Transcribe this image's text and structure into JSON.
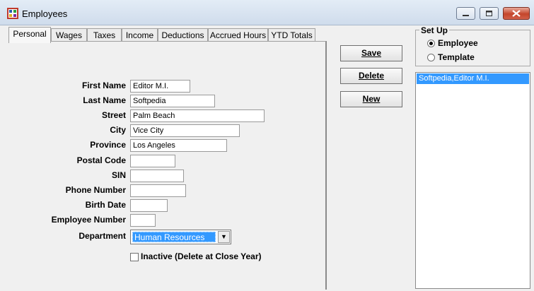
{
  "window": {
    "title": "Employees"
  },
  "tabs": [
    {
      "label": "Personal"
    },
    {
      "label": "Wages"
    },
    {
      "label": "Taxes"
    },
    {
      "label": "Income"
    },
    {
      "label": "Deductions"
    },
    {
      "label": "Accrued Hours"
    },
    {
      "label": "YTD Totals"
    }
  ],
  "form": {
    "fields": [
      {
        "label": "First Name",
        "value": "Editor M.I."
      },
      {
        "label": "Last Name",
        "value": "Softpedia"
      },
      {
        "label": "Street",
        "value": "Palm Beach"
      },
      {
        "label": "City",
        "value": "Vice City"
      },
      {
        "label": "Province",
        "value": "Los Angeles"
      },
      {
        "label": "Postal Code",
        "value": ""
      },
      {
        "label": "SIN",
        "value": ""
      },
      {
        "label": "Phone Number",
        "value": ""
      },
      {
        "label": "Birth Date",
        "value": ""
      },
      {
        "label": "Employee Number",
        "value": ""
      }
    ],
    "department": {
      "label": "Department",
      "value": "Human Resources"
    },
    "inactive": {
      "label": "Inactive (Delete at Close Year)",
      "checked": false
    }
  },
  "buttons": {
    "save": "Save",
    "delete": "Delete",
    "new": "New"
  },
  "setup": {
    "title": "Set Up",
    "options": [
      {
        "label": "Employee",
        "selected": true
      },
      {
        "label": "Template",
        "selected": false
      }
    ]
  },
  "employee_list": [
    {
      "name": "Softpedia,Editor M.I.",
      "selected": true
    }
  ],
  "icons": {
    "app": "employees-app-icon",
    "minimize": "minimize-icon",
    "maximize": "maximize-icon",
    "close": "close-icon",
    "dropdown": "chevron-down-icon"
  },
  "colors": {
    "selection": "#3399ff",
    "close_button": "#c4452b"
  }
}
